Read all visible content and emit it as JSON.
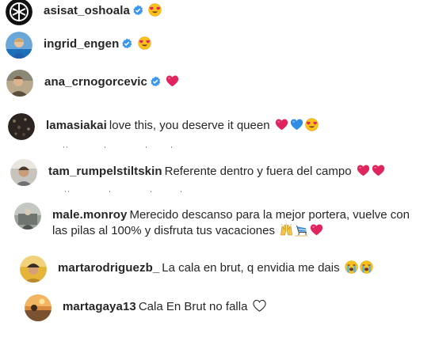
{
  "comments": [
    {
      "username": "asisat_oshoala",
      "verified": true,
      "text": "",
      "emojis": [
        "heart-eyes"
      ]
    },
    {
      "username": "ingrid_engen",
      "verified": true,
      "text": "",
      "emojis": [
        "heart-eyes"
      ]
    },
    {
      "username": "ana_crnogorcevic",
      "verified": true,
      "text": "",
      "emojis": [
        "red-heart"
      ]
    },
    {
      "username": "lamasiakai",
      "verified": false,
      "text": "love this, you deserve it queen",
      "emojis": [
        "red-heart",
        "blue-heart",
        "heart-eyes"
      ]
    },
    {
      "username": "tam_rumpelstiltskin",
      "verified": false,
      "text": "Referente dentro y fuera del campo",
      "emojis": [
        "red-heart",
        "red-heart"
      ]
    },
    {
      "username": "male.monroy",
      "verified": false,
      "text": "Merecido descanso para la mejor portera, vuelve con las pilas al 100% y disfruta tus vacaciones",
      "emojis": [
        "raised-hands",
        "beach-chair",
        "red-heart"
      ]
    },
    {
      "username": "martarodriguezb_",
      "verified": false,
      "text": "La cala en brut, q envidia me dais",
      "emojis": [
        "crying",
        "crying"
      ]
    },
    {
      "username": "martagaya13",
      "verified": false,
      "text": "Cala En Brut no falla",
      "emojis": [
        "white-heart"
      ]
    }
  ],
  "colors": {
    "text": "#262626",
    "verified": "#3897f0",
    "heart_red": "#e0245e",
    "heart_blue": "#2e8ee6"
  }
}
